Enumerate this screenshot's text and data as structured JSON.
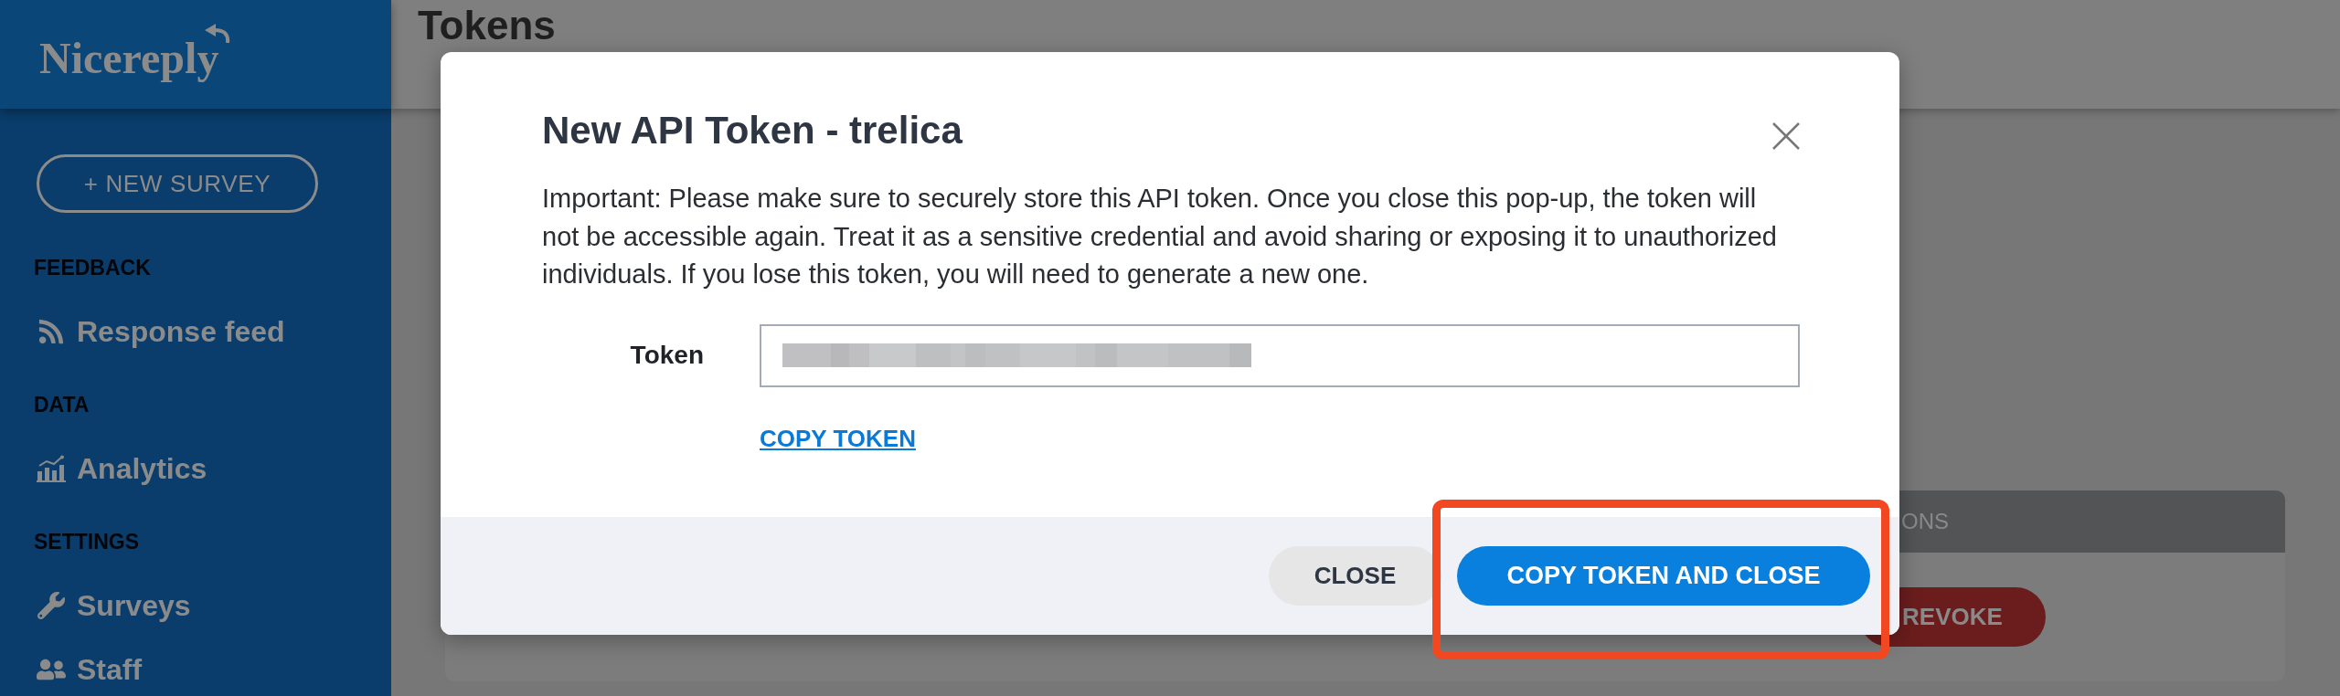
{
  "sidebar": {
    "logo": "Nicereply",
    "new_survey_button": "+ NEW SURVEY",
    "sections": [
      {
        "title": "FEEDBACK",
        "items": [
          {
            "label": "Response feed"
          }
        ]
      },
      {
        "title": "DATA",
        "items": [
          {
            "label": "Analytics"
          }
        ]
      },
      {
        "title": "SETTINGS",
        "items": [
          {
            "label": "Surveys"
          },
          {
            "label": "Staff"
          }
        ]
      }
    ]
  },
  "page": {
    "title": "Tokens",
    "table": {
      "column_header": "ONS",
      "row_button": "REVOKE"
    }
  },
  "dialog": {
    "title": "New API Token - trelica",
    "message": "Important: Please make sure to securely store this API token. Once you close this pop-up, the token will not be accessible again. Treat it as a sensitive credential and avoid sharing or exposing it to unauthorized individuals. If you lose this token, you will need to generate a new one.",
    "field": {
      "label": "Token"
    },
    "copy_link": "COPY TOKEN",
    "buttons": [
      {
        "label": "CLOSE",
        "kind": "secondary"
      },
      {
        "label": "COPY TOKEN AND CLOSE",
        "kind": "primary"
      }
    ]
  }
}
